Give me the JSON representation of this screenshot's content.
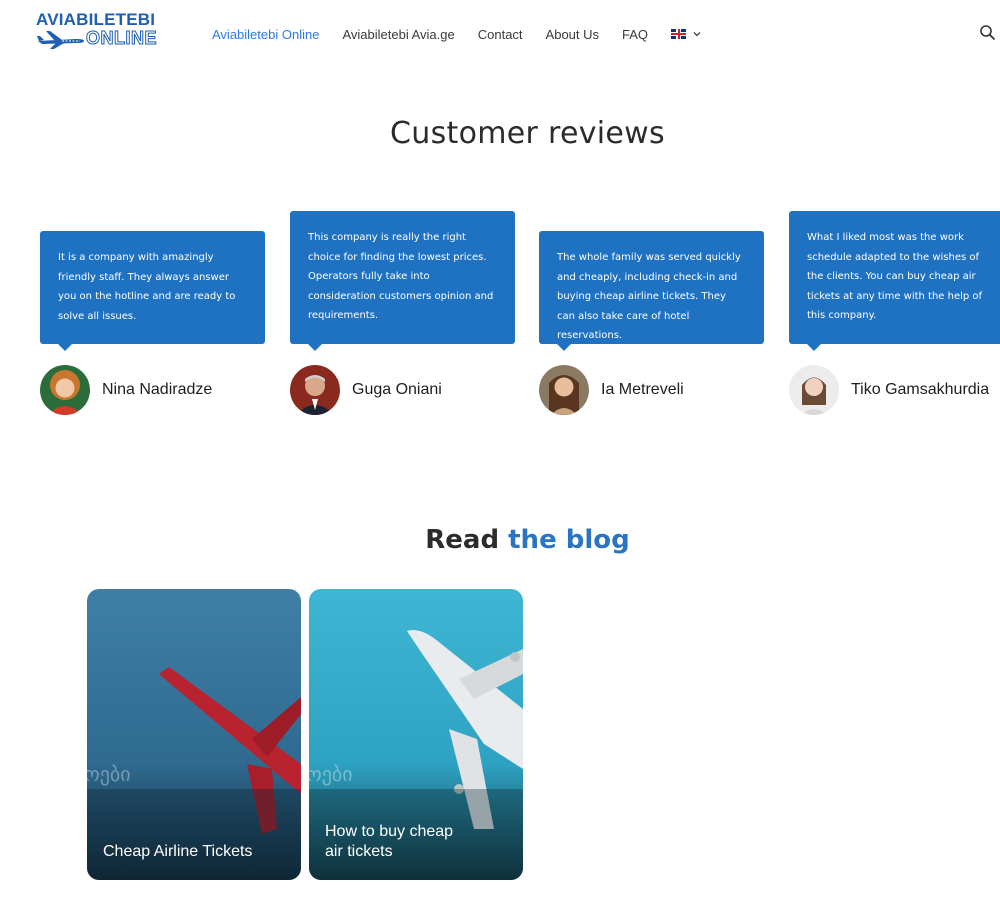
{
  "header": {
    "logo": {
      "line1": "AVIABILETEBI",
      "line2": "ONLINE"
    },
    "nav": [
      {
        "label": "Aviabiletebi Online",
        "active": true
      },
      {
        "label": "Aviabiletebi Avia.ge",
        "active": false
      },
      {
        "label": "Contact",
        "active": false
      },
      {
        "label": "About Us",
        "active": false
      },
      {
        "label": "FAQ",
        "active": false
      }
    ],
    "language_icon": "uk-flag-icon",
    "search_icon": "search-icon"
  },
  "reviews": {
    "title": "Customer reviews",
    "items": [
      {
        "text": "It is a company with amazingly friendly staff. They always answer you on the hotline and are ready to solve all issues.",
        "name": "Nina Nadiradze"
      },
      {
        "text": "This company is really the right choice for finding the lowest prices. Operators fully take into consideration customers opinion and requirements.",
        "name": "Guga Oniani"
      },
      {
        "text": "The whole family was served quickly and cheaply, including check-in and buying cheap airline tickets. They can also take care of hotel reservations.",
        "name": "Ia Metreveli"
      },
      {
        "text": "What I liked most was the work schedule adapted to the wishes of the clients. You can buy cheap air tickets at any time with the help of this company.",
        "name": "Tiko Gamsakhurdia"
      }
    ]
  },
  "blog": {
    "title_plain": "Read",
    "title_accent": "the blog",
    "cards": [
      {
        "title": "Cheap Airline Tickets",
        "ghost": "ოები"
      },
      {
        "title": "How to buy cheap air tickets",
        "ghost": "ოები"
      }
    ]
  },
  "colors": {
    "brand": "#1d5fb3",
    "accent": "#2a7be4",
    "bubble": "#1f71c2"
  }
}
